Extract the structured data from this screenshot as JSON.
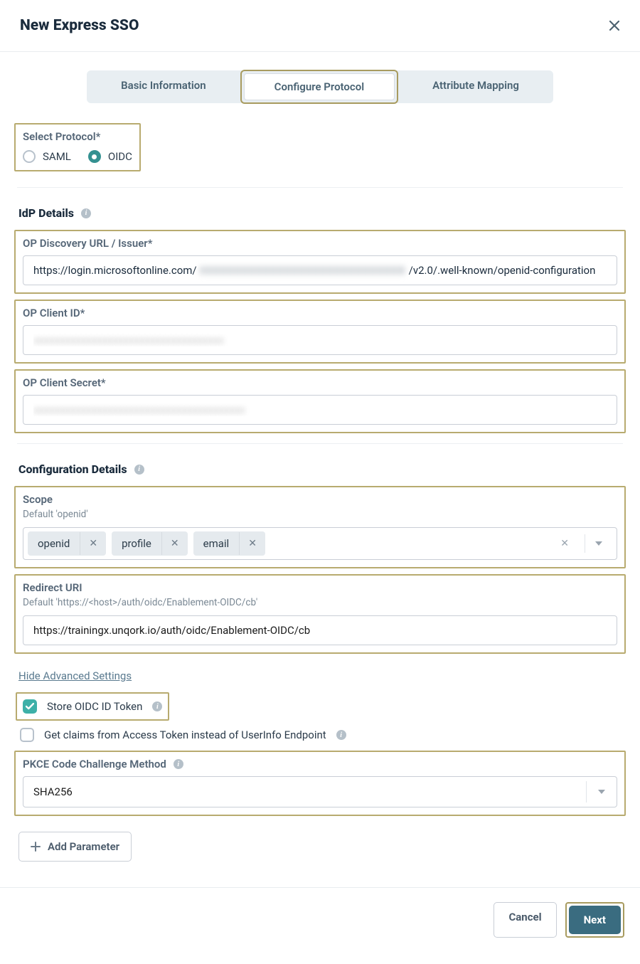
{
  "header": {
    "title": "New Express SSO"
  },
  "tabs": {
    "basic": "Basic Information",
    "configure": "Configure Protocol",
    "mapping": "Attribute Mapping"
  },
  "protocol": {
    "label": "Select Protocol*",
    "options": {
      "saml": "SAML",
      "oidc": "OIDC"
    },
    "selected": "oidc"
  },
  "idp": {
    "heading": "IdP Details",
    "discovery": {
      "label": "OP Discovery URL / Issuer*",
      "value_prefix": "https://login.microsoftonline.com/",
      "value_suffix": "/v2.0/.well-known/openid-configuration"
    },
    "client_id": {
      "label": "OP Client ID*"
    },
    "client_secret": {
      "label": "OP Client Secret*"
    }
  },
  "config": {
    "heading": "Configuration Details",
    "scope": {
      "label": "Scope",
      "sublabel": "Default 'openid'",
      "chips": [
        "openid",
        "profile",
        "email"
      ]
    },
    "redirect": {
      "label": "Redirect URI",
      "sublabel": "Default 'https://<host>/auth/oidc/Enablement-OIDC/cb'",
      "value": "https://trainingx.unqork.io/auth/oidc/Enablement-OIDC/cb"
    },
    "advanced_link": "Hide Advanced Settings",
    "store_token": {
      "label": "Store OIDC ID Token",
      "checked": true
    },
    "access_claims": {
      "label": "Get claims from Access Token instead of UserInfo Endpoint",
      "checked": false
    },
    "pkce": {
      "label": "PKCE Code Challenge Method",
      "value": "SHA256"
    },
    "add_param": "Add Parameter"
  },
  "footer": {
    "cancel": "Cancel",
    "next": "Next"
  }
}
